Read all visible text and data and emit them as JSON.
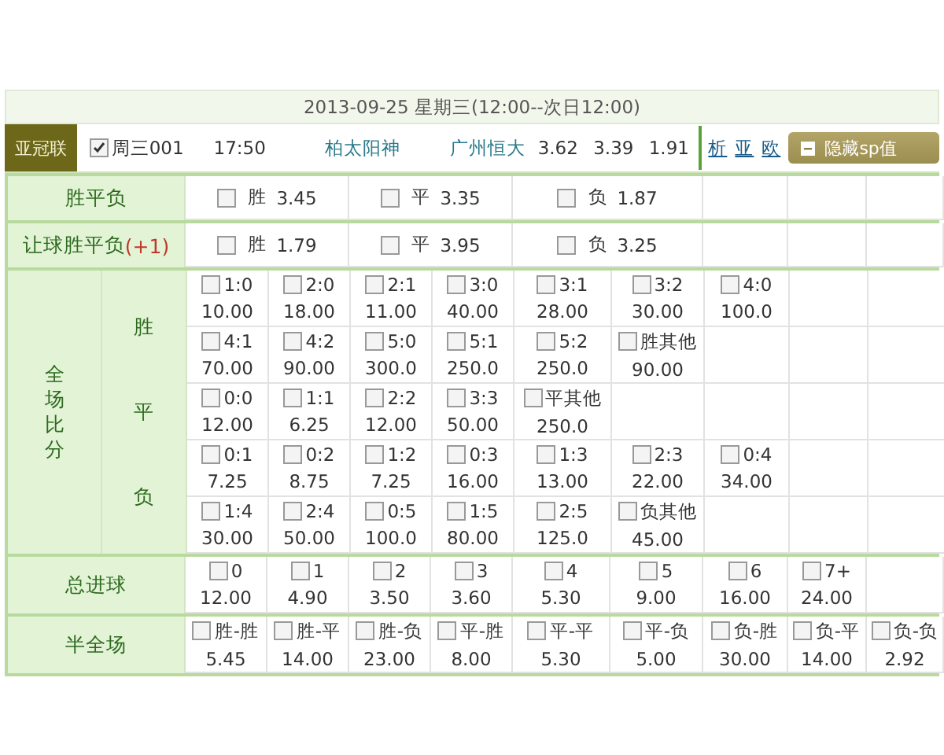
{
  "date_header": "2013-09-25 星期三(12:00--次日12:00)",
  "match": {
    "league": "亚冠联",
    "checked": true,
    "code": "周三001",
    "time": "17:50",
    "home": "柏太阳神",
    "away": "广州恒大",
    "odds": [
      "3.62",
      "3.39",
      "1.91"
    ],
    "links": [
      "析",
      "亚",
      "欧"
    ],
    "toggle_button": "隐藏sp值"
  },
  "sections": [
    {
      "kind": "simple",
      "label": "胜平负",
      "options": [
        {
          "label": "胜",
          "odds": "3.45",
          "checked": false
        },
        {
          "label": "平",
          "odds": "3.35",
          "checked": false
        },
        {
          "label": "负",
          "odds": "1.87",
          "checked": false
        }
      ]
    },
    {
      "kind": "simple",
      "label": "让球胜平负",
      "handicap": "(+1)",
      "options": [
        {
          "label": "胜",
          "odds": "1.79",
          "checked": false
        },
        {
          "label": "平",
          "odds": "3.95",
          "checked": false
        },
        {
          "label": "负",
          "odds": "3.25",
          "checked": false
        }
      ]
    },
    {
      "kind": "scores",
      "label": "全场比分",
      "groups": [
        {
          "label": "胜",
          "rows": [
            [
              {
                "label": "1:0",
                "odds": "10.00",
                "checked": false
              },
              {
                "label": "2:0",
                "odds": "18.00",
                "checked": false
              },
              {
                "label": "2:1",
                "odds": "11.00",
                "checked": false
              },
              {
                "label": "3:0",
                "odds": "40.00",
                "checked": false
              },
              {
                "label": "3:1",
                "odds": "28.00",
                "checked": false
              },
              {
                "label": "3:2",
                "odds": "30.00",
                "checked": false
              },
              {
                "label": "4:0",
                "odds": "100.0",
                "checked": false
              }
            ],
            [
              {
                "label": "4:1",
                "odds": "70.00",
                "checked": false
              },
              {
                "label": "4:2",
                "odds": "90.00",
                "checked": false
              },
              {
                "label": "5:0",
                "odds": "300.0",
                "checked": false
              },
              {
                "label": "5:1",
                "odds": "250.0",
                "checked": false
              },
              {
                "label": "5:2",
                "odds": "250.0",
                "checked": false
              },
              {
                "label": "胜其他",
                "odds": "90.00",
                "checked": false
              }
            ]
          ]
        },
        {
          "label": "平",
          "rows": [
            [
              {
                "label": "0:0",
                "odds": "12.00",
                "checked": false
              },
              {
                "label": "1:1",
                "odds": "6.25",
                "checked": false
              },
              {
                "label": "2:2",
                "odds": "12.00",
                "checked": false
              },
              {
                "label": "3:3",
                "odds": "50.00",
                "checked": false
              },
              {
                "label": "平其他",
                "odds": "250.0",
                "checked": false
              }
            ]
          ]
        },
        {
          "label": "负",
          "rows": [
            [
              {
                "label": "0:1",
                "odds": "7.25",
                "checked": false
              },
              {
                "label": "0:2",
                "odds": "8.75",
                "checked": false
              },
              {
                "label": "1:2",
                "odds": "7.25",
                "checked": false
              },
              {
                "label": "0:3",
                "odds": "16.00",
                "checked": false
              },
              {
                "label": "1:3",
                "odds": "13.00",
                "checked": false
              },
              {
                "label": "2:3",
                "odds": "22.00",
                "checked": false
              },
              {
                "label": "0:4",
                "odds": "34.00",
                "checked": false
              }
            ],
            [
              {
                "label": "1:4",
                "odds": "30.00",
                "checked": false
              },
              {
                "label": "2:4",
                "odds": "50.00",
                "checked": false
              },
              {
                "label": "0:5",
                "odds": "100.0",
                "checked": false
              },
              {
                "label": "1:5",
                "odds": "80.00",
                "checked": false
              },
              {
                "label": "2:5",
                "odds": "125.0",
                "checked": false
              },
              {
                "label": "负其他",
                "odds": "45.00",
                "checked": false
              }
            ]
          ]
        }
      ]
    },
    {
      "kind": "grid",
      "label": "总进球",
      "options": [
        {
          "label": "0",
          "odds": "12.00",
          "checked": false
        },
        {
          "label": "1",
          "odds": "4.90",
          "checked": false
        },
        {
          "label": "2",
          "odds": "3.50",
          "checked": false
        },
        {
          "label": "3",
          "odds": "3.60",
          "checked": false
        },
        {
          "label": "4",
          "odds": "5.30",
          "checked": false
        },
        {
          "label": "5",
          "odds": "9.00",
          "checked": false
        },
        {
          "label": "6",
          "odds": "16.00",
          "checked": false
        },
        {
          "label": "7+",
          "odds": "24.00",
          "checked": false
        }
      ]
    },
    {
      "kind": "grid",
      "label": "半全场",
      "options": [
        {
          "label": "胜-胜",
          "odds": "5.45",
          "checked": false
        },
        {
          "label": "胜-平",
          "odds": "14.00",
          "checked": false
        },
        {
          "label": "胜-负",
          "odds": "23.00",
          "checked": false
        },
        {
          "label": "平-胜",
          "odds": "8.00",
          "checked": false
        },
        {
          "label": "平-平",
          "odds": "5.30",
          "checked": false
        },
        {
          "label": "平-负",
          "odds": "5.00",
          "checked": false
        },
        {
          "label": "负-胜",
          "odds": "30.00",
          "checked": false
        },
        {
          "label": "负-平",
          "odds": "14.00",
          "checked": false
        },
        {
          "label": "负-负",
          "odds": "2.92",
          "checked": false
        }
      ]
    }
  ]
}
